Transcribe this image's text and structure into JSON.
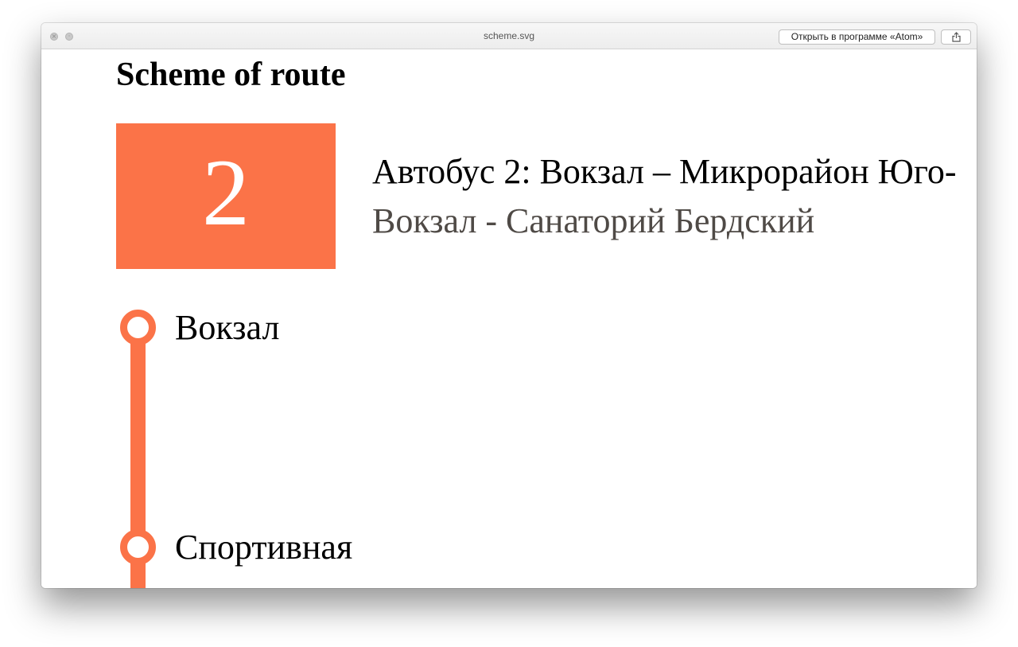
{
  "window": {
    "title": "scheme.svg",
    "open_button_label": "Открыть в программе «Atom»",
    "share_icon": "share-icon",
    "close_icon": "close-icon",
    "minimize_icon": "minimize-icon"
  },
  "page": {
    "title": "Scheme of route"
  },
  "route": {
    "number": "2",
    "name": "Автобус 2: Вокзал – Микрорайон Юго-",
    "stops_summary": "Вокзал - Санаторий Бердский",
    "color": "#fb7348"
  },
  "stops": [
    {
      "name": "Вокзал"
    },
    {
      "name": "Спортивная"
    }
  ]
}
